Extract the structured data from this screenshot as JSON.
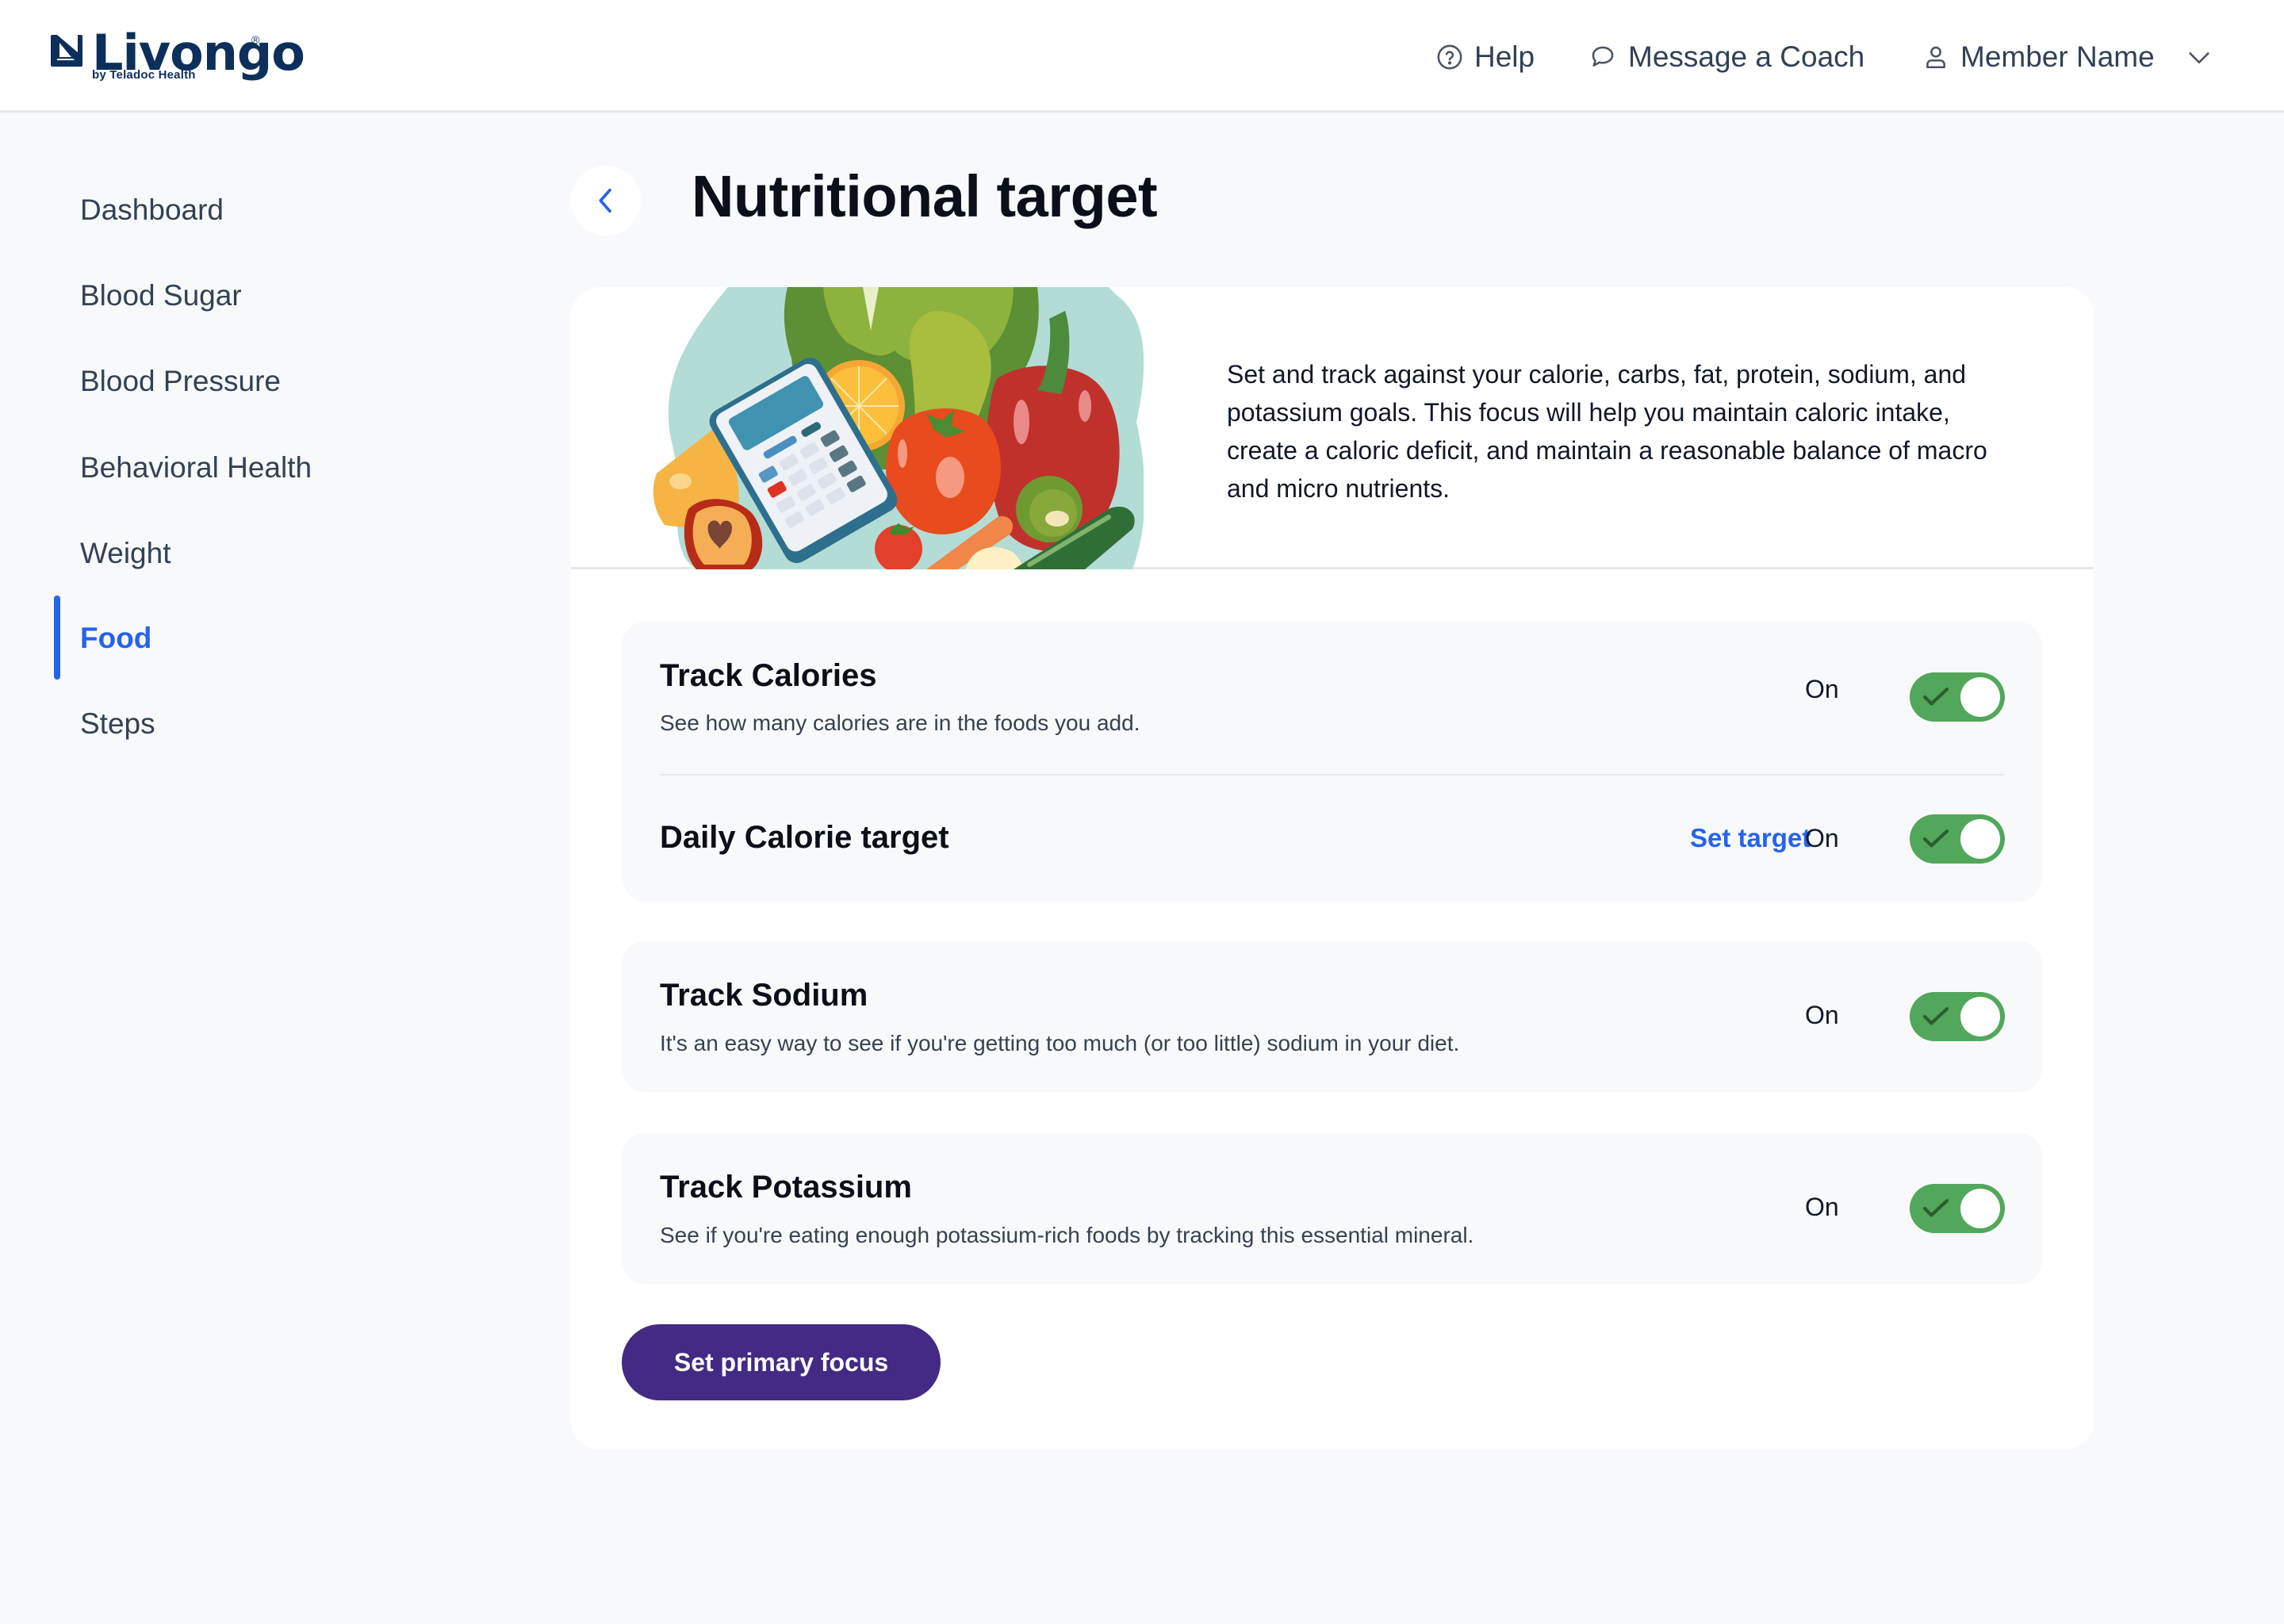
{
  "header": {
    "logo_text": "Livongo",
    "logo_registered": "®",
    "logo_subtext": "by Teladoc Health",
    "help_label": "Help",
    "coach_label": "Message a Coach",
    "member_label": "Member Name"
  },
  "sidebar": {
    "items": [
      {
        "label": "Dashboard",
        "active": false
      },
      {
        "label": "Blood Sugar",
        "active": false
      },
      {
        "label": "Blood Pressure",
        "active": false
      },
      {
        "label": "Behavioral Health",
        "active": false
      },
      {
        "label": "Weight",
        "active": false
      },
      {
        "label": "Food",
        "active": true
      },
      {
        "label": "Steps",
        "active": false
      }
    ]
  },
  "page": {
    "title": "Nutritional target",
    "description": "Set and track against your calorie, carbs, fat, protein, sodium, and potassium goals. This focus will help you maintain caloric intake, create a caloric deficit, and maintain a reasonable balance of macro and micro nutrients."
  },
  "settings": {
    "calories": {
      "title": "Track Calories",
      "subtitle": "See how many calories are in the foods you add.",
      "state_label": "On",
      "enabled": true
    },
    "daily_target": {
      "title": "Daily Calorie target",
      "link_label": "Set target",
      "state_label": "On",
      "enabled": true
    },
    "sodium": {
      "title": "Track Sodium",
      "subtitle": "It's an easy way to see if you're getting too much (or too little) sodium in your diet.",
      "state_label": "On",
      "enabled": true
    },
    "potassium": {
      "title": "Track Potassium",
      "subtitle": "See if you're eating enough potassium-rich foods by tracking this essential mineral.",
      "state_label": "On",
      "enabled": true
    }
  },
  "actions": {
    "primary_focus_label": "Set primary focus"
  },
  "colors": {
    "brand_navy": "#0d2f5b",
    "accent_blue": "#2563eb",
    "toggle_green": "#52a75a",
    "primary_button": "#432a84"
  }
}
